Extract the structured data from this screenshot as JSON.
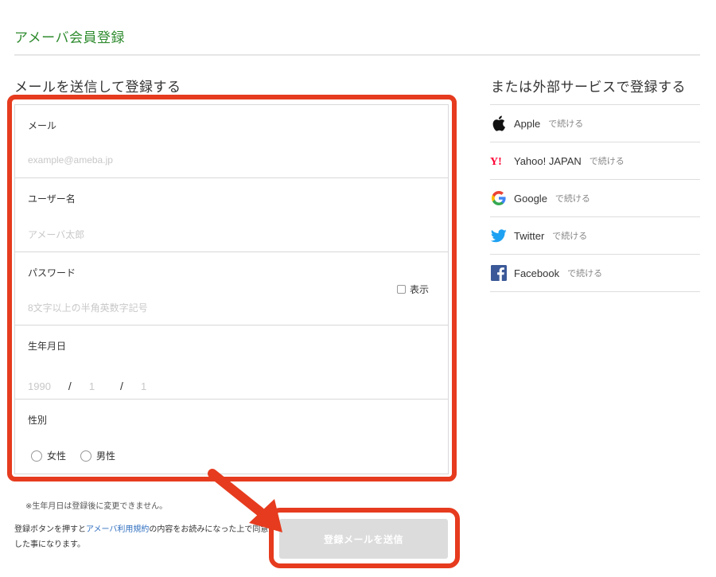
{
  "page": {
    "title": "アメーバ会員登録",
    "left_heading": "メールを送信して登録する",
    "right_heading": "または外部サービスで登録する"
  },
  "form": {
    "email": {
      "label": "メール",
      "placeholder": "example@ameba.jp"
    },
    "username": {
      "label": "ユーザー名",
      "placeholder": "アメーバ太郎"
    },
    "password": {
      "label": "パスワード",
      "placeholder": "8文字以上の半角英数字記号",
      "show_label": "表示"
    },
    "birthday": {
      "label": "生年月日",
      "year": "1990",
      "month": "1",
      "day": "1",
      "separator": "/"
    },
    "gender": {
      "label": "性別",
      "options": [
        "女性",
        "男性"
      ]
    },
    "birthday_note": "※生年月日は登録後に変更できません。",
    "terms_prefix": "登録ボタンを押すと",
    "terms_link": "アメーバ利用規約",
    "terms_suffix": "の内容をお読みになった上で同意した事になります。",
    "submit_label": "登録メールを送信"
  },
  "social": {
    "items": [
      {
        "name": "Apple",
        "suffix": "で続ける",
        "icon": "apple-icon"
      },
      {
        "name": "Yahoo! JAPAN",
        "suffix": "で続ける",
        "icon": "yahoo-icon",
        "color": "#ff0033"
      },
      {
        "name": "Google",
        "suffix": "で続ける",
        "icon": "google-icon"
      },
      {
        "name": "Twitter",
        "suffix": "で続ける",
        "icon": "twitter-icon",
        "color": "#1da1f2"
      },
      {
        "name": "Facebook",
        "suffix": "で続ける",
        "icon": "facebook-icon",
        "color": "#3b5998"
      }
    ]
  },
  "colors": {
    "title_green": "#2e8b2e",
    "highlight_red": "#e63b1e",
    "link_blue": "#2f6fbf",
    "button_disabled": "#dcdcdc"
  }
}
